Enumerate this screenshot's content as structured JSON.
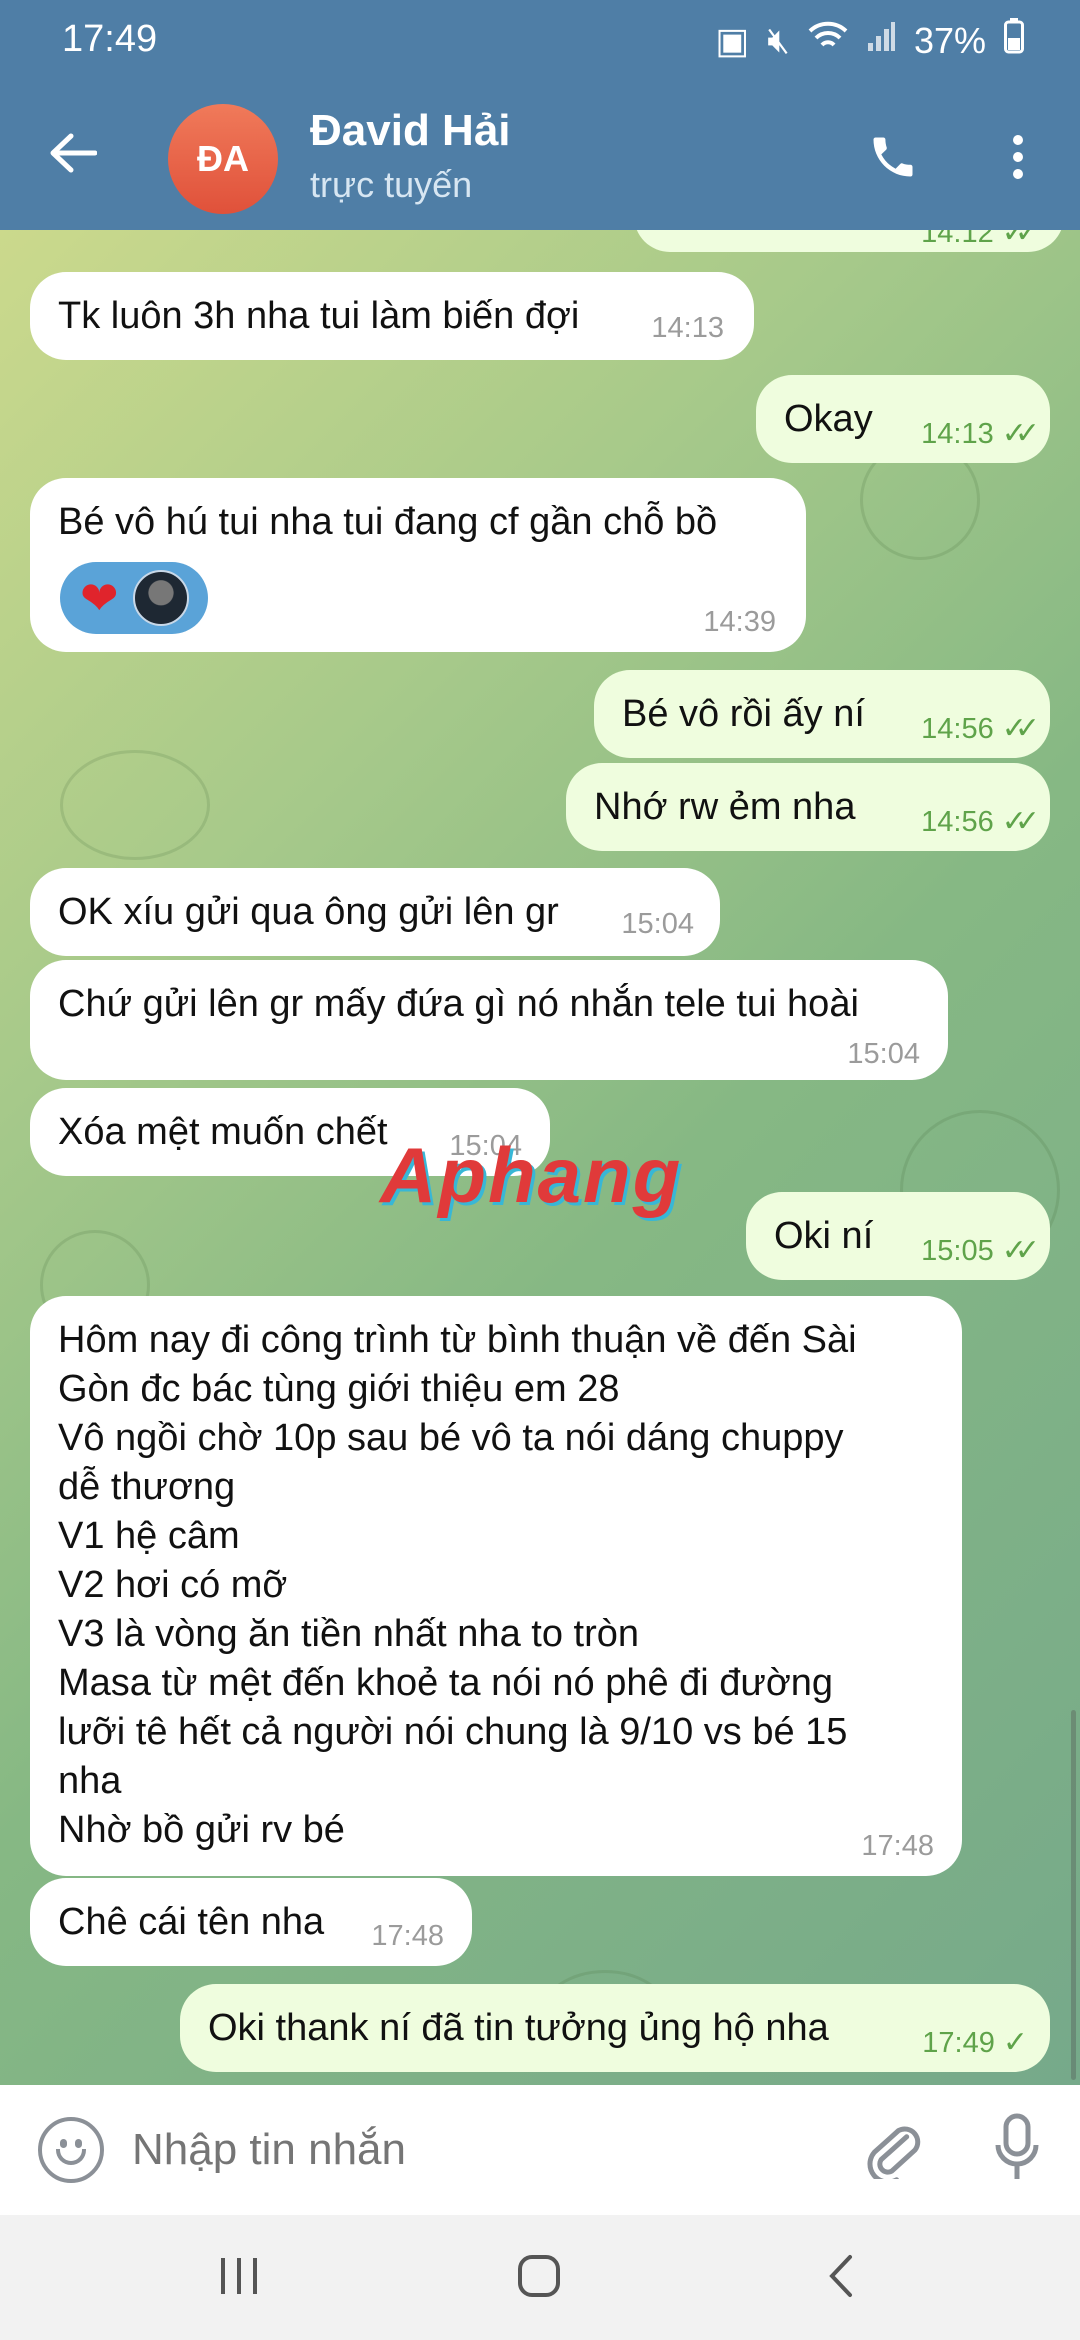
{
  "status_bar": {
    "time": "17:49",
    "battery": "37%"
  },
  "header": {
    "avatar_initials": "ĐA",
    "contact_name": "Đavid Hải",
    "contact_status": "trực tuyến"
  },
  "messages": [
    {
      "dir": "out",
      "text": "",
      "time": "14:12",
      "ticks": "double"
    },
    {
      "dir": "in",
      "text": "Tk luôn 3h nha tui làm biến đợi",
      "time": "14:13"
    },
    {
      "dir": "out",
      "text": "Okay",
      "time": "14:13",
      "ticks": "double"
    },
    {
      "dir": "in",
      "text": "Bé vô hú tui nha tui đang cf gần chỗ bồ",
      "time": "14:39",
      "reaction": "❤"
    },
    {
      "dir": "out",
      "text": "Bé vô rồi ấy ní",
      "time": "14:56",
      "ticks": "double"
    },
    {
      "dir": "out",
      "text": "Nhớ rw ẻm nha",
      "time": "14:56",
      "ticks": "double"
    },
    {
      "dir": "in",
      "text": "OK xíu gửi qua ông gửi lên gr",
      "time": "15:04"
    },
    {
      "dir": "in",
      "text": "Chứ gửi lên gr mấy đứa gì nó nhắn tele tui hoài",
      "time": "15:04"
    },
    {
      "dir": "in",
      "text": "Xóa mệt muốn chết",
      "time": "15:04"
    },
    {
      "dir": "out",
      "text": "Oki ní",
      "time": "15:05",
      "ticks": "double"
    },
    {
      "dir": "in",
      "text": "Hôm nay đi công trình từ bình thuận về đến Sài\nGòn đc bác tùng giới thiệu em 28\nVô ngồi chờ 10p sau bé vô ta nói dáng chuppy\ndễ thương\nV1 hệ câm\nV2 hơi có mỡ\nV3 là vòng ăn tiền nhất nha to tròn\nMasa từ mệt đến khoẻ ta nói nó phê đi đường\nlưỡi tê hết cả người nói chung là 9/10 vs bé 15\nnha\nNhờ bồ gửi rv bé",
      "time": "17:48"
    },
    {
      "dir": "in",
      "text": "Chê cái tên nha",
      "time": "17:48"
    },
    {
      "dir": "out",
      "text": "Oki thank ní đã tin tưởng ủng hộ nha",
      "time": "17:49",
      "ticks": "single"
    }
  ],
  "watermark": "Aphang",
  "composer": {
    "placeholder": "Nhập tin nhắn"
  },
  "icons": {
    "back": "arrow-left-icon",
    "call": "phone-icon",
    "more": "more-vert-icon",
    "emoji": "smiley-icon",
    "attach": "paperclip-icon",
    "mic": "microphone-icon"
  },
  "colors": {
    "header": "#4f7ea6",
    "outgoing_bubble": "#effdde",
    "incoming_bubble": "#ffffff",
    "tick": "#5fa34a",
    "avatar": "#e9603f"
  }
}
